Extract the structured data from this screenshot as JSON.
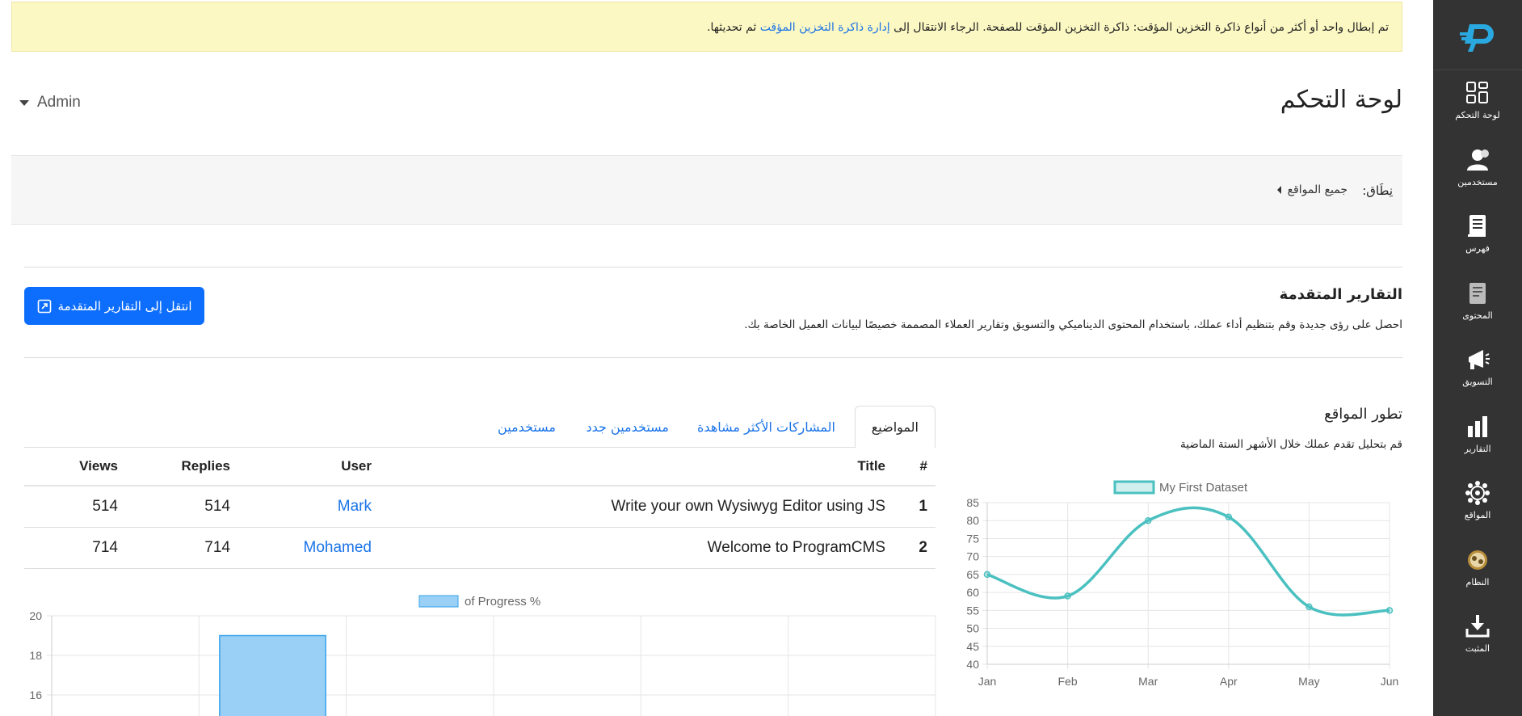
{
  "alert": {
    "text_before": "تم إبطال واحد أو أكثر من أنواع ذاكرة التخزين المؤقت: ذاكرة التخزين المؤقت للصفحة. الرجاء الانتقال إلى",
    "link": "إدارة ذاكرة التخزين المؤقت",
    "text_after": "ثم تحديثها."
  },
  "header": {
    "title": "لوحة التحكم",
    "user": "Admin"
  },
  "scope": {
    "label": "نِطَاق:",
    "value": "جميع المواقع"
  },
  "advanced_reports": {
    "title": "التقارير المتقدمة",
    "description": "احصل على رؤى جديدة وقم بتنظيم أداء عملك، باستخدام المحتوى الديناميكي والتسويق وتقارير العملاء المصممة خصيصًا لبيانات العميل الخاصة بك.",
    "button": "انتقل إلى التقارير المتقدمة"
  },
  "sites_evolution": {
    "title": "تطور المواقع",
    "description": "قم بتحليل تقدم عملك خلال الأشهر الستة الماضية"
  },
  "sidebar": {
    "items": [
      {
        "label": "لوحة التحكم",
        "icon": "dashboard-icon"
      },
      {
        "label": "مستخدمين",
        "icon": "users-icon"
      },
      {
        "label": "فهرس",
        "icon": "catalog-icon"
      },
      {
        "label": "المحتوى",
        "icon": "content-icon"
      },
      {
        "label": "التسويق",
        "icon": "marketing-icon"
      },
      {
        "label": "التقارير",
        "icon": "reports-icon"
      },
      {
        "label": "المواقع",
        "icon": "sites-icon"
      },
      {
        "label": "النظام",
        "icon": "system-icon"
      },
      {
        "label": "المثبت",
        "icon": "installer-icon"
      }
    ]
  },
  "tabs": [
    {
      "label": "المواضيع",
      "active": true
    },
    {
      "label": "المشاركات الأكثر مشاهدة",
      "active": false
    },
    {
      "label": "مستخدمين جدد",
      "active": false
    },
    {
      "label": "مستخدمين",
      "active": false
    }
  ],
  "table": {
    "columns": {
      "num": "#",
      "title": "Title",
      "user": "User",
      "replies": "Replies",
      "views": "Views"
    },
    "rows": [
      {
        "num": "1",
        "title": "Write your own Wysiwyg Editor using JS",
        "user": "Mark",
        "replies": "514",
        "views": "514"
      },
      {
        "num": "2",
        "title": "Welcome to ProgramCMS",
        "user": "Mohamed",
        "replies": "714",
        "views": "714"
      }
    ]
  },
  "colors": {
    "sidebar": "#333333",
    "accent": "#0d6efd",
    "link": "#1a73e8",
    "alert_bg": "#fcf8c3",
    "line": "#4bc0c0",
    "bar": "#9ad0f5",
    "bar_border": "#36a2eb"
  },
  "chart_data": [
    {
      "type": "line",
      "legend": "My First Dataset",
      "categories": [
        "Jan",
        "Feb",
        "Mar",
        "Apr",
        "May",
        "Jun"
      ],
      "series": [
        {
          "name": "My First Dataset",
          "values": [
            65,
            59,
            80,
            81,
            56,
            55
          ]
        }
      ],
      "ylim": [
        40,
        85
      ],
      "yticks": [
        85,
        80,
        75,
        70,
        65,
        60,
        55,
        50,
        45,
        40
      ],
      "grid": true,
      "legend_position": "top"
    },
    {
      "type": "bar",
      "legend": "of Progress %",
      "series": [
        {
          "name": "of Progress %",
          "values": [
            null,
            19,
            null,
            null,
            null,
            null
          ]
        }
      ],
      "yticks_visible": [
        20,
        18,
        16
      ],
      "grid": true,
      "legend_position": "top"
    }
  ]
}
